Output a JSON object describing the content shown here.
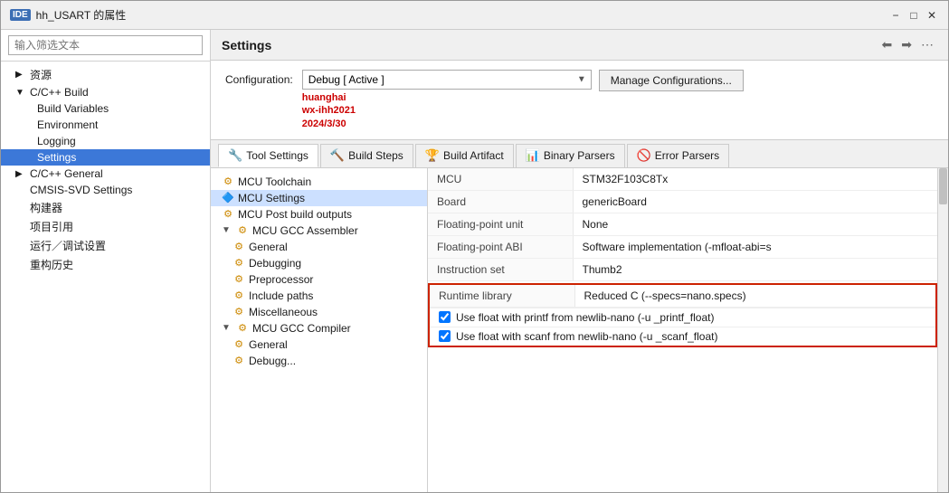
{
  "window": {
    "title": "hh_USART 的属性",
    "ide_badge": "IDE"
  },
  "sidebar": {
    "search_placeholder": "输入筛选文本",
    "items": [
      {
        "id": "resources",
        "label": "资源",
        "indent": 0,
        "toggle": "▶",
        "selected": false
      },
      {
        "id": "cpp-build",
        "label": "C/C++ Build",
        "indent": 0,
        "toggle": "▼",
        "selected": false
      },
      {
        "id": "build-variables",
        "label": "Build Variables",
        "indent": 1,
        "toggle": "",
        "selected": false
      },
      {
        "id": "environment",
        "label": "Environment",
        "indent": 1,
        "toggle": "",
        "selected": false
      },
      {
        "id": "logging",
        "label": "Logging",
        "indent": 1,
        "toggle": "",
        "selected": false
      },
      {
        "id": "settings",
        "label": "Settings",
        "indent": 1,
        "toggle": "",
        "selected": true
      },
      {
        "id": "cpp-general",
        "label": "C/C++ General",
        "indent": 0,
        "toggle": "▶",
        "selected": false
      },
      {
        "id": "cmsis-svd",
        "label": "CMSIS-SVD Settings",
        "indent": 0,
        "toggle": "",
        "selected": false
      },
      {
        "id": "builder",
        "label": "构建器",
        "indent": 0,
        "toggle": "",
        "selected": false
      },
      {
        "id": "project-ref",
        "label": "项目引用",
        "indent": 0,
        "toggle": "",
        "selected": false
      },
      {
        "id": "run-debug",
        "label": "运行／调试设置",
        "indent": 0,
        "toggle": "",
        "selected": false
      },
      {
        "id": "refactor-history",
        "label": "重构历史",
        "indent": 0,
        "toggle": "",
        "selected": false
      }
    ]
  },
  "panel": {
    "title": "Settings",
    "config_label": "Configuration:",
    "config_value": "Debug  [ Active ]",
    "annotation_line1": "huanghai",
    "annotation_line2": "wx-ihh2021",
    "annotation_line3": "2024/3/30",
    "manage_btn_label": "Manage Configurations..."
  },
  "tabs": [
    {
      "id": "tool-settings",
      "label": "Tool Settings",
      "icon": "🔧",
      "active": true
    },
    {
      "id": "build-steps",
      "label": "Build Steps",
      "icon": "🔨",
      "active": false
    },
    {
      "id": "build-artifact",
      "label": "Build Artifact",
      "icon": "🏆",
      "active": false
    },
    {
      "id": "binary-parsers",
      "label": "Binary Parsers",
      "icon": "📊",
      "active": false
    },
    {
      "id": "error-parsers",
      "label": "Error Parsers",
      "icon": "🚫",
      "active": false
    }
  ],
  "tree_items": [
    {
      "id": "mcu-toolchain",
      "label": "MCU Toolchain",
      "indent": 0,
      "icon": "gear",
      "toggle": "",
      "selected": false
    },
    {
      "id": "mcu-settings",
      "label": "MCU Settings",
      "indent": 0,
      "icon": "chip",
      "toggle": "",
      "selected": true
    },
    {
      "id": "mcu-post-build",
      "label": "MCU Post build outputs",
      "indent": 0,
      "icon": "gear",
      "toggle": "",
      "selected": false
    },
    {
      "id": "mcu-gcc-assembler",
      "label": "MCU GCC Assembler",
      "indent": 0,
      "icon": "gear",
      "toggle": "▼",
      "selected": false
    },
    {
      "id": "general",
      "label": "General",
      "indent": 1,
      "icon": "gear",
      "toggle": "",
      "selected": false
    },
    {
      "id": "debugging",
      "label": "Debugging",
      "indent": 1,
      "icon": "gear",
      "toggle": "",
      "selected": false
    },
    {
      "id": "preprocessor",
      "label": "Preprocessor",
      "indent": 1,
      "icon": "gear",
      "toggle": "",
      "selected": false
    },
    {
      "id": "include-paths",
      "label": "Include paths",
      "indent": 1,
      "icon": "gear",
      "toggle": "",
      "selected": false
    },
    {
      "id": "miscellaneous",
      "label": "Miscellaneous",
      "indent": 1,
      "icon": "gear",
      "toggle": "",
      "selected": false
    },
    {
      "id": "mcu-gcc-compiler",
      "label": "MCU GCC Compiler",
      "indent": 0,
      "icon": "gear",
      "toggle": "▼",
      "selected": false
    },
    {
      "id": "gcc-general",
      "label": "General",
      "indent": 1,
      "icon": "gear",
      "toggle": "",
      "selected": false
    },
    {
      "id": "debugg2",
      "label": "Debugg...",
      "indent": 1,
      "icon": "gear",
      "toggle": "",
      "selected": false
    }
  ],
  "settings_fields": [
    {
      "id": "mcu",
      "label": "MCU",
      "value": "STM32F103C8Tx",
      "highlighted": false
    },
    {
      "id": "board",
      "label": "Board",
      "value": "genericBoard",
      "highlighted": false
    },
    {
      "id": "floating-point-unit",
      "label": "Floating-point unit",
      "value": "None",
      "highlighted": false
    },
    {
      "id": "floating-point-abi",
      "label": "Floating-point ABI",
      "value": "Software implementation (-mfloat-abi=s",
      "highlighted": false
    },
    {
      "id": "instruction-set",
      "label": "Instruction set",
      "value": "Thumb2",
      "highlighted": false
    },
    {
      "id": "runtime-library",
      "label": "Runtime library",
      "value": "Reduced C (--specs=nano.specs)",
      "highlighted": true
    }
  ],
  "checkboxes": [
    {
      "id": "use-float-printf",
      "label": "Use float with printf from newlib-nano (-u _printf_float)",
      "checked": true
    },
    {
      "id": "use-float-scanf",
      "label": "Use float with scanf from newlib-nano (-u _scanf_float)",
      "checked": true
    }
  ]
}
